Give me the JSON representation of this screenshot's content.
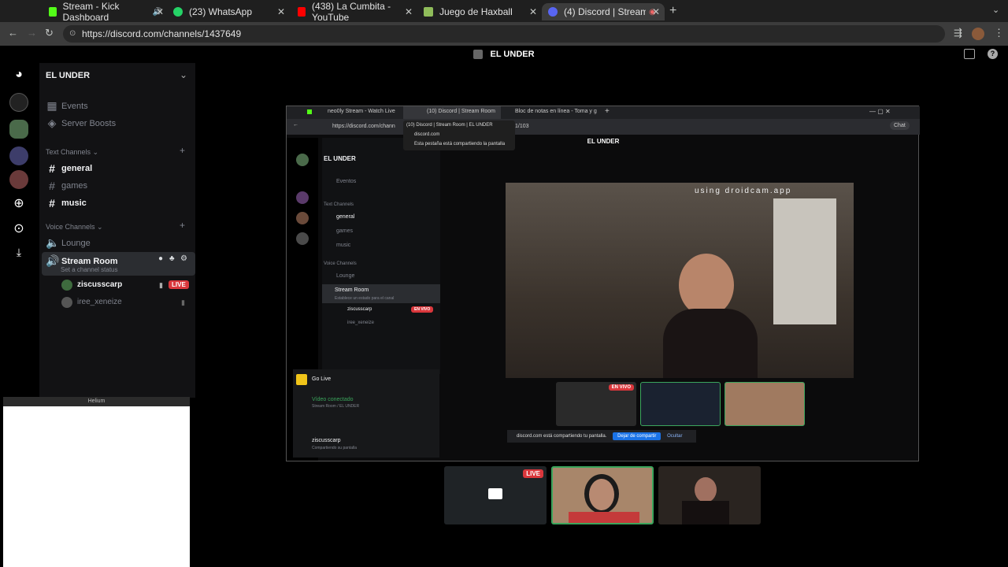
{
  "browser": {
    "tabs": [
      {
        "label": "Stream - Kick Dashboard",
        "icon": "kick-icon",
        "color": "#53fc18"
      },
      {
        "label": "(23) WhatsApp",
        "icon": "whatsapp-icon",
        "color": "#25d366"
      },
      {
        "label": "(438) La Cumbita - YouTube",
        "icon": "youtube-icon",
        "color": "#ff0000"
      },
      {
        "label": "Juego de Haxball",
        "icon": "haxball-icon",
        "color": "#8fbc5a"
      },
      {
        "label": "(4) Discord | Stream Room",
        "icon": "discord-icon",
        "color": "#5865f2"
      }
    ],
    "url": "https://discord.com/channels/1437649"
  },
  "discord": {
    "window_title": "EL UNDER",
    "server_name": "EL UNDER",
    "menu": [
      {
        "label": "Events",
        "icon": "calendar-icon"
      },
      {
        "label": "Server Boosts",
        "icon": "boost-icon"
      }
    ],
    "text_channels_label": "Text Channels",
    "text_channels": [
      {
        "label": "general",
        "bright": true
      },
      {
        "label": "games",
        "bright": false
      },
      {
        "label": "music",
        "bright": true
      }
    ],
    "voice_channels_label": "Voice Channels",
    "voice_channels": [
      {
        "label": "Lounge"
      },
      {
        "label": "Stream Room",
        "status": "Set a channel status"
      }
    ],
    "voice_users": [
      {
        "name": "ziscusscarp",
        "badge": "LIVE"
      },
      {
        "name": "iree_xeneize",
        "badge": ""
      }
    ],
    "helium_title": "Helium"
  },
  "shared_screen": {
    "tabs": [
      "neo0ly Stream - Watch Live",
      "(10) Discord | Stream Room",
      "Bloc de notas en línea - Toma y g"
    ],
    "url": "https://discord.com/chann",
    "url_suffix": "1/103",
    "tooltip": {
      "title": "(10) Discord | Stream Room | EL UNDER",
      "site": "discord.com",
      "note": "Esta pestaña está compartiendo la pantalla"
    },
    "title": "EL UNDER",
    "server_name": "EL UNDER",
    "menu_label": "Eventos",
    "text_channels_label": "Text Channels",
    "text_channels": [
      "general",
      "games",
      "music"
    ],
    "voice_channels_label": "Voice Channels",
    "voice_channels": [
      "Lounge",
      "Stream Room"
    ],
    "stream_status": "Establece un estado para el canal",
    "voice_users": [
      {
        "name": "ziscusscarp",
        "badge": "EN VIVO"
      },
      {
        "name": "iree_xeneize",
        "badge": ""
      }
    ],
    "go_live": "Go Live",
    "video_connected": "Vídeo conectado",
    "connection_sub": "Stream Room / EL UNDER",
    "user_name": "ziscusscarp",
    "user_status": "Compartiendo su pantalla",
    "cam_overlay": "using droidcam.app",
    "thumb_live": "EN VIVO",
    "share_bar_text": "discord.com está compartiendo tu pantalla.",
    "stop_share": "Dejar de compartir",
    "hide": "Ocultar",
    "chat_label": "Chat"
  },
  "bottom_thumbs": [
    {
      "label": "screen",
      "badge": "LIVE"
    },
    {
      "label": "cam-1",
      "badge": ""
    },
    {
      "label": "cam-2",
      "badge": ""
    }
  ]
}
